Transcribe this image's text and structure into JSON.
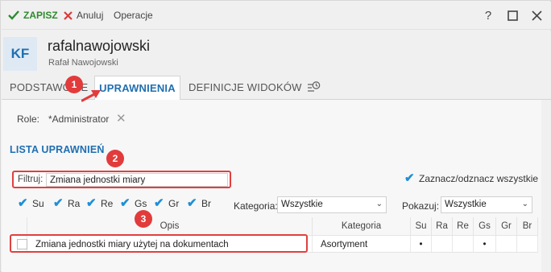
{
  "toolbar": {
    "save_label": "ZAPISZ",
    "cancel_label": "Anuluj",
    "operations_label": "Operacje"
  },
  "window": {
    "help_glyph": "?",
    "maximize_icon": "maximize-icon",
    "close_icon": "close-icon"
  },
  "user": {
    "initials": "KF",
    "login": "rafalnawojowski",
    "full_name": "Rafał Nawojowski"
  },
  "tabs": [
    {
      "label": "PODSTAWOWE",
      "active": false
    },
    {
      "label": "UPRAWNIENIA",
      "active": true
    },
    {
      "label": "DEFINICJE WIDOKÓW",
      "active": false
    },
    {
      "label": "",
      "icon": "history-icon",
      "active": false
    }
  ],
  "roles": {
    "label": "Role:",
    "value": "*Administrator"
  },
  "permissions": {
    "title": "LISTA UPRAWNIEŃ",
    "filter_label": "Filtruj:",
    "filter_value": "Zmiana jednostki miary",
    "select_all_label": "Zaznacz/odznacz wszystkie",
    "column_filters": [
      {
        "label": "Su",
        "checked": true
      },
      {
        "label": "Ra",
        "checked": true
      },
      {
        "label": "Re",
        "checked": true
      },
      {
        "label": "Gs",
        "checked": true
      },
      {
        "label": "Gr",
        "checked": true
      },
      {
        "label": "Br",
        "checked": true
      }
    ],
    "category_label": "Kategoria:",
    "category_value": "Wszystkie",
    "show_label": "Pokazuj:",
    "show_value": "Wszystkie",
    "table": {
      "headers": [
        "",
        "Opis",
        "Kategoria",
        "Su",
        "Ra",
        "Re",
        "Gs",
        "Gr",
        "Br"
      ],
      "rows": [
        {
          "checked": false,
          "description": "Zmiana jednostki miary użytej na dokumentach",
          "category": "Asortyment",
          "flags": [
            "•",
            "",
            "",
            "•",
            "",
            ""
          ]
        }
      ]
    }
  },
  "callouts": [
    "1",
    "2",
    "3"
  ],
  "colors": {
    "accent": "#1f6fb2",
    "save_green": "#2e8b2e",
    "cancel_red": "#d83b3b",
    "callout_red": "#e23b3b",
    "check_blue": "#1f8fd6"
  }
}
